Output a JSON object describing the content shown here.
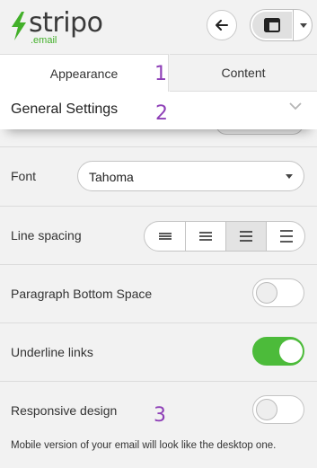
{
  "header": {
    "brand": "stripo",
    "brand_sub": ".email",
    "back_icon": "arrow-left-icon",
    "layout_icon": "layout-icon",
    "dropdown_icon": "caret-down-icon"
  },
  "tabs": [
    {
      "label": "Appearance",
      "active": true
    },
    {
      "label": "Content",
      "active": false
    }
  ],
  "markers": [
    "1",
    "2",
    "3"
  ],
  "general_settings": {
    "title": "General Settings",
    "icon": "chevron-down-icon"
  },
  "font": {
    "label": "Font",
    "value": "Tahoma"
  },
  "line_spacing": {
    "label": "Line spacing",
    "options": [
      "compact",
      "normal",
      "relaxed",
      "loose"
    ],
    "selected_index": 2
  },
  "paragraph_bottom_space": {
    "label": "Paragraph Bottom Space",
    "enabled": false
  },
  "underline_links": {
    "label": "Underline links",
    "enabled": true
  },
  "responsive_design": {
    "label": "Responsive design",
    "enabled": false,
    "hint": "Mobile version of your email will look like the desktop one."
  },
  "colors": {
    "accent_green": "#4cbb3a",
    "marker_purple": "#8e3fb7"
  }
}
